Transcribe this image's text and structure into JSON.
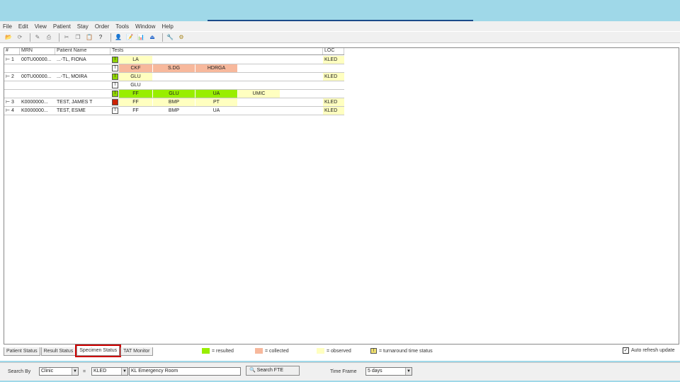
{
  "menu": [
    "File",
    "Edit",
    "View",
    "Patient",
    "Stay",
    "Order",
    "Tools",
    "Window",
    "Help"
  ],
  "toolbar_icons": [
    "open-icon",
    "refresh-icon",
    "edit-icon",
    "print-icon",
    "cut-icon",
    "copy-icon",
    "paste-icon",
    "help-icon",
    "patient-icon",
    "order-icon",
    "results-icon",
    "exit-icon",
    "tools-icon",
    "settings-icon"
  ],
  "grid": {
    "headers": {
      "num": "#",
      "mrn": "MRN",
      "name": "Patient Name",
      "tests": "Tests",
      "loc": "LOC"
    },
    "rows": [
      {
        "num": "1",
        "mrn": "00TU00000...",
        "name": "...-TL, FIONA",
        "icon": "T",
        "icon_color": "#8fd400",
        "tests": [
          {
            "label": "LA",
            "status": "observed"
          }
        ],
        "loc": "KLED"
      },
      {
        "num": "",
        "mrn": "",
        "name": "",
        "icon": "T",
        "icon_color": "#ffffff",
        "tests": [
          {
            "label": "CKF",
            "status": "collected"
          },
          {
            "label": "S.DG",
            "status": "collected"
          },
          {
            "label": "HDRGA",
            "status": "collected"
          }
        ],
        "loc": ""
      },
      {
        "num": "2",
        "mrn": "00TU00000...",
        "name": "...-TL, MOIRA",
        "icon": "T",
        "icon_color": "#8fd400",
        "tests": [
          {
            "label": "GLU",
            "status": "observed"
          }
        ],
        "loc": "KLED"
      },
      {
        "num": "",
        "mrn": "",
        "name": "",
        "icon": "T",
        "icon_color": "#ffffff",
        "tests": [
          {
            "label": "GLU",
            "status": "none"
          }
        ],
        "loc": ""
      },
      {
        "num": "",
        "mrn": "",
        "name": "",
        "icon": "T",
        "icon_color": "#8fd400",
        "tests": [
          {
            "label": "FF",
            "status": "resulted"
          },
          {
            "label": "GLU",
            "status": "resulted"
          },
          {
            "label": "UA",
            "status": "resulted"
          },
          {
            "label": "UMIC",
            "status": "observed"
          }
        ],
        "loc": ""
      },
      {
        "num": "3",
        "mrn": "K0000000...",
        "name": "TEST, JAMES T",
        "icon": "",
        "icon_color": "#cc2200",
        "tests": [
          {
            "label": "FF",
            "status": "observed"
          },
          {
            "label": "BMP",
            "status": "observed"
          },
          {
            "label": "PT",
            "status": "observed"
          }
        ],
        "loc": "KLED"
      },
      {
        "num": "4",
        "mrn": "K0000000...",
        "name": "TEST, ESME",
        "icon": "T",
        "icon_color": "#ffffff",
        "tests": [
          {
            "label": "FF",
            "status": "none"
          },
          {
            "label": "BMP",
            "status": "none"
          },
          {
            "label": "UA",
            "status": "none"
          }
        ],
        "loc": "KLED"
      }
    ]
  },
  "tabs": [
    {
      "label": "Patient Status",
      "active": false
    },
    {
      "label": "Result Status",
      "active": false
    },
    {
      "label": "Specimen Status",
      "active": true
    },
    {
      "label": "TAT Monitor",
      "active": false
    }
  ],
  "legend": [
    {
      "label": "= resulted",
      "color": "#99ee00"
    },
    {
      "label": "= collected",
      "color": "#f7b89c"
    },
    {
      "label": "= observed",
      "color": "#ffffc0"
    },
    {
      "label": "= turnaround time status",
      "color": "#f0e070"
    }
  ],
  "auto_refresh": {
    "label": "Auto refresh update",
    "checked": true
  },
  "bottom": {
    "search_by_label": "Search By",
    "search_by_value": "Clinic",
    "eq_label": "=",
    "clinic_value": "KLED",
    "clinic_name": "KL Emergency Room",
    "search_button": "Search FTE",
    "timeframe_label": "Time Frame",
    "timeframe_value": "5 days"
  },
  "colors": {
    "resulted": "#99ee00",
    "collected": "#f7b89c",
    "observed": "#ffffc0",
    "none": "#ffffff",
    "highlight": "#cc0000"
  }
}
